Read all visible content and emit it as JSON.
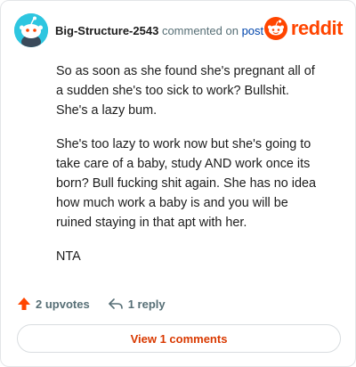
{
  "header": {
    "username": "Big-Structure-2543",
    "commented_text": "commented on",
    "post_link": "post",
    "logo_text": "reddit"
  },
  "comment": {
    "paragraphs": [
      "So as soon as she found she's pregnant all of a sudden she's too sick to work? Bullshit. She's a lazy bum.",
      "She's too lazy to work now but she's going to take care of a baby, study AND work once its born? Bull fucking shit again. She has no idea how much work a baby is and you will be ruined staying in that apt with her.",
      "NTA"
    ]
  },
  "actions": {
    "upvotes": "2 upvotes",
    "replies": "1 reply"
  },
  "view_comments_label": "View 1 comments",
  "colors": {
    "brand": "#ff4500",
    "avatar_bg": "#2ec6e0",
    "link": "#0045ac",
    "muted": "#576f76",
    "view_button_text": "#d93900"
  }
}
